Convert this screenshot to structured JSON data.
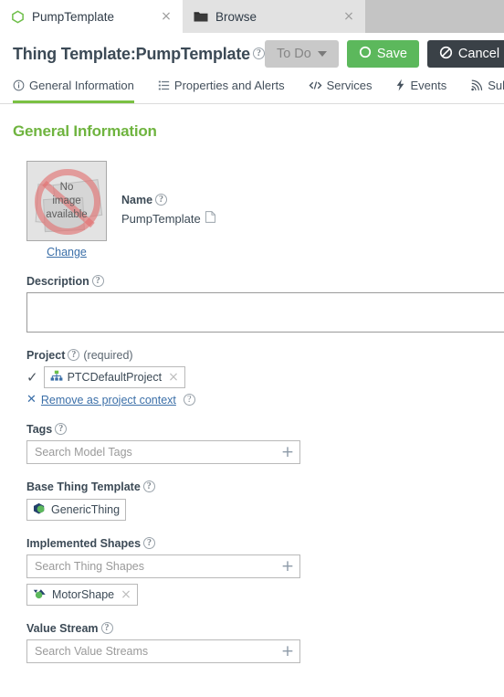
{
  "browser_tabs": [
    {
      "label": "PumpTemplate",
      "icon": "hexagon-outline-green-icon",
      "active": true,
      "close": "×"
    },
    {
      "label": "Browse",
      "icon": "folder-icon",
      "active": false,
      "close": "×"
    }
  ],
  "header": {
    "title": "Thing Template:PumpTemplate",
    "title_help": "?",
    "status_dropdown": {
      "label": "To Do",
      "icon": "chevron-down-icon"
    },
    "save_button": {
      "label": "Save",
      "icon": "circle-icon",
      "color": "#5cb85c"
    },
    "cancel_button": {
      "label": "Cancel",
      "icon": "no-entry-icon",
      "color": "#3a4147"
    }
  },
  "section_tabs": [
    {
      "label": "General Information",
      "icon": "info-circle-icon",
      "active": true
    },
    {
      "label": "Properties and Alerts",
      "icon": "list-icon",
      "active": false
    },
    {
      "label": "Services",
      "icon": "code-icon",
      "active": false
    },
    {
      "label": "Events",
      "icon": "lightning-bolt-icon",
      "active": false
    },
    {
      "label": "Subs",
      "icon": "broadcast-icon",
      "active": false
    }
  ],
  "general_information": {
    "heading": "General Information",
    "heading_color": "#6fb43f",
    "image": {
      "placeholder_line1": "No",
      "placeholder_line2": "image",
      "placeholder_line3": "available",
      "change_link": "Change"
    },
    "name": {
      "label": "Name",
      "help": "?",
      "value": "PumpTemplate",
      "copy_icon": "copy-icon"
    },
    "description": {
      "label": "Description",
      "help": "?",
      "value": "",
      "placeholder": ""
    },
    "project": {
      "label": "Project",
      "help": "?",
      "required_text": "(required)",
      "selected": "PTCDefaultProject",
      "chip_icon": "project-tree-icon",
      "chip_remove": "×",
      "check": "✓",
      "remove_context_link": "Remove as project context",
      "remove_context_help": "?",
      "remove_context_x": "✕"
    },
    "tags": {
      "label": "Tags",
      "help": "?",
      "placeholder": "Search Model Tags",
      "value": "",
      "add_icon": "plus-icon"
    },
    "base_thing_template": {
      "label": "Base Thing Template",
      "help": "?",
      "value": "GenericThing",
      "chip_icon": "thing-hexagon-icon"
    },
    "implemented_shapes": {
      "label": "Implemented Shapes",
      "help": "?",
      "placeholder": "Search Thing Shapes",
      "value": "",
      "add_icon": "plus-icon",
      "chips": [
        {
          "label": "MotorShape",
          "icon": "shape-icon",
          "remove": "×"
        }
      ]
    },
    "value_stream": {
      "label": "Value Stream",
      "help": "?",
      "placeholder": "Search Value Streams",
      "value": "",
      "add_icon": "plus-icon"
    }
  }
}
